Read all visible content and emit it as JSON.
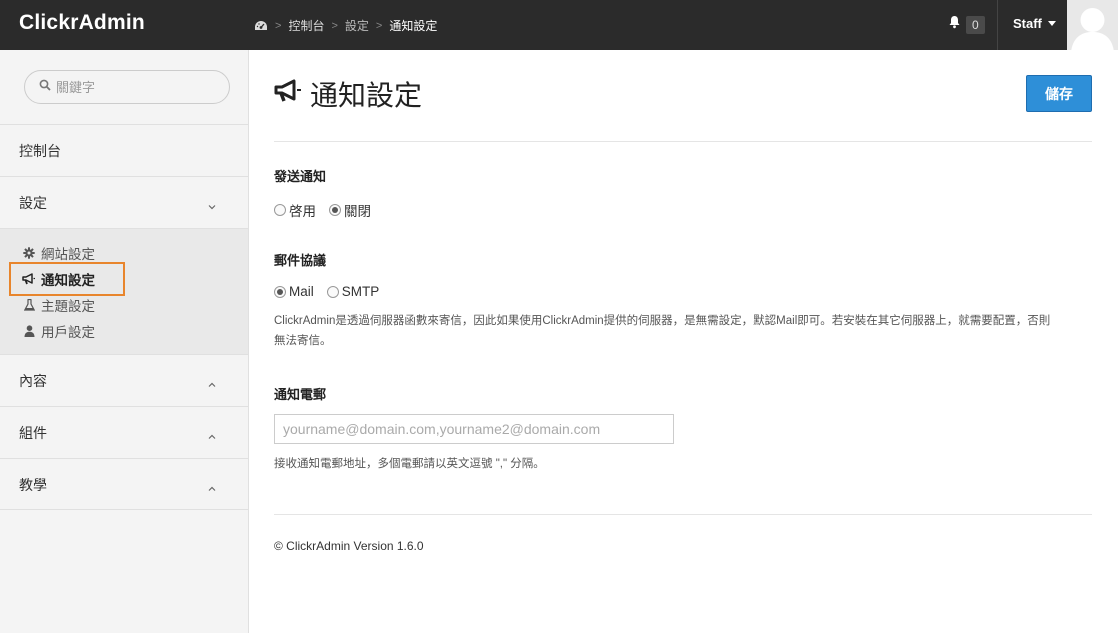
{
  "header": {
    "brand": "ClickrAdmin",
    "breadcrumb": [
      "控制台",
      "設定",
      "通知設定"
    ],
    "notification_count": "0",
    "user": "Staff",
    "icons": {
      "dashboard": "dashboard-icon",
      "bell": "bell-icon",
      "caret": "caret-down-icon"
    }
  },
  "sidebar": {
    "search_placeholder": "關鍵字",
    "items": [
      {
        "label": "控制台"
      },
      {
        "label": "設定",
        "expanded": true
      },
      {
        "label": "內容",
        "expanded": false
      },
      {
        "label": "組件",
        "expanded": false
      },
      {
        "label": "教學",
        "expanded": false
      }
    ],
    "settings_sub": [
      {
        "label": "網站設定",
        "icon": "gear-icon"
      },
      {
        "label": "通知設定",
        "icon": "bullhorn-icon",
        "active": true
      },
      {
        "label": "主題設定",
        "icon": "flask-icon"
      },
      {
        "label": "用戶設定",
        "icon": "user-icon"
      }
    ]
  },
  "main": {
    "title": "通知設定",
    "save_label": "儲存",
    "send_notice": {
      "label": "發送通知",
      "options": [
        "啓用",
        "關閉"
      ],
      "selected": "關閉"
    },
    "mail_protocol": {
      "label": "郵件協議",
      "options": [
        "Mail",
        "SMTP"
      ],
      "selected": "Mail",
      "help_line1": "ClickrAdmin是透過伺服器函數來寄信，因此如果使用ClickrAdmin提供的伺服器，是無需設定，默認Mail即可。若安裝在其它伺服器上，就需要配置，否則",
      "help_line2": "無法寄信。"
    },
    "notice_email": {
      "label": "通知電郵",
      "placeholder": "yourname@domain.com,yourname2@domain.com",
      "value": "",
      "help": "接收通知電郵地址，多個電郵請以英文逗號 \",\" 分隔。"
    },
    "footer": "© ClickrAdmin Version 1.6.0"
  },
  "colors": {
    "topbar": "#2b2b2b",
    "primary": "#2e8fd8",
    "highlight": "#e8852c",
    "sidebar": "#f4f4f4"
  }
}
